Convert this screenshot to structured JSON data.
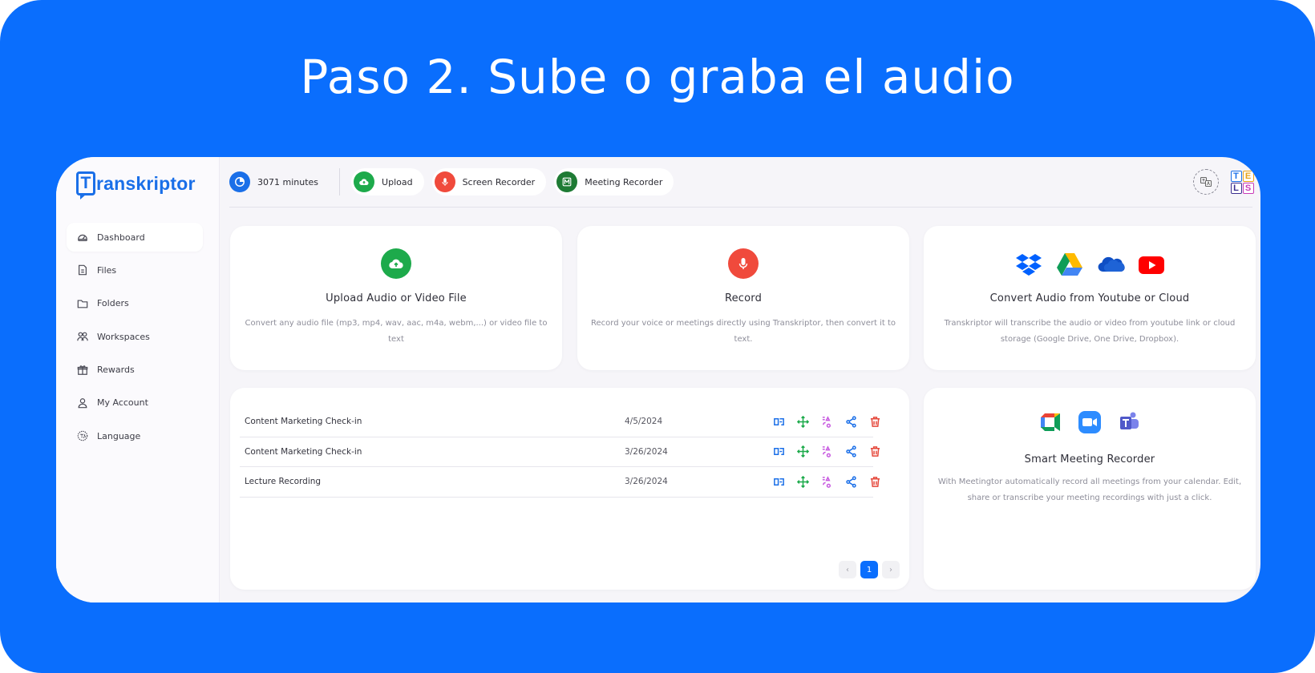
{
  "headline": "Paso 2. Sube o graba el audio",
  "brand": {
    "name": "ranskriptor",
    "mark_letter": "T"
  },
  "sidebar": {
    "items": [
      {
        "label": "Dashboard",
        "icon": "gauge-icon",
        "active": true
      },
      {
        "label": "Files",
        "icon": "file-icon"
      },
      {
        "label": "Folders",
        "icon": "folder-icon"
      },
      {
        "label": "Workspaces",
        "icon": "users-icon"
      },
      {
        "label": "Rewards",
        "icon": "gift-icon"
      },
      {
        "label": "My Account",
        "icon": "user-icon"
      },
      {
        "label": "Language",
        "icon": "globe-icon"
      }
    ]
  },
  "topbar": {
    "minutes": "3071 minutes",
    "upload": "Upload",
    "screen_recorder": "Screen Recorder",
    "meeting_recorder": "Meeting Recorder",
    "tels": [
      "T",
      "E",
      "L",
      "S"
    ]
  },
  "cards": {
    "upload": {
      "title": "Upload Audio or Video File",
      "desc": "Convert any audio file (mp3, mp4, wav, aac, m4a, webm,...) or video file to text"
    },
    "record": {
      "title": "Record",
      "desc": "Record your voice or meetings directly using Transkriptor, then convert it to text."
    },
    "cloud": {
      "title": "Convert Audio from Youtube or Cloud",
      "desc": "Transkriptor will transcribe the audio or video from youtube link or cloud storage (Google Drive, One Drive, Dropbox).",
      "icons": [
        "dropbox-icon",
        "google-drive-icon",
        "onedrive-icon",
        "youtube-icon"
      ]
    },
    "meeting": {
      "title": "Smart Meeting Recorder",
      "desc": "With Meetingtor automatically record all meetings from your calendar. Edit, share or transcribe your meeting recordings with just a click.",
      "icons": [
        "google-meet-icon",
        "zoom-icon",
        "teams-icon"
      ]
    }
  },
  "files": {
    "rows": [
      {
        "name": "Content Marketing Check-in",
        "date": "4/5/2024"
      },
      {
        "name": "Content Marketing Check-in",
        "date": "3/26/2024"
      },
      {
        "name": "Lecture Recording",
        "date": "3/26/2024"
      }
    ],
    "pager": {
      "prev": "‹",
      "current": "1",
      "next": "›"
    }
  },
  "colors": {
    "brand_blue": "#0A6EFD",
    "upload_green": "#1DAA4B",
    "record_red": "#F04A3C",
    "meeting_green": "#1E7B34",
    "delete_red": "#E5483B"
  }
}
